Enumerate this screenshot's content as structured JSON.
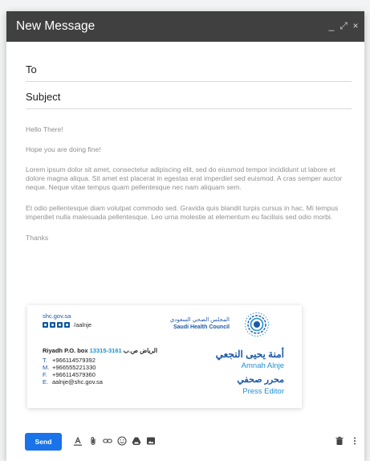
{
  "header": {
    "title": "New Message",
    "controls": {
      "minimize": "_",
      "expand": "⤢",
      "close": "×"
    }
  },
  "fields": {
    "to_label": "To",
    "to_value": "",
    "subject_label": "Subject",
    "subject_value": ""
  },
  "body": {
    "greeting": "Hello There!",
    "line2": "Hope you are doing fine!",
    "para1": "Lorem ipsum dolor sit amet, consectetur adipiscing elit, sed do eiusmod tempor incididunt ut labore et dolore magna aliqua. Sit amet est placerat in egestas erat imperdiet sed euismod. A cras semper auctor neque. Neque vitae tempus quam pellentesque nec nam aliquam sem.",
    "para2": " Et odio pellentesque diam volutpat commodo sed. Gravida quis blandit turpis cursus in hac. Mi tempus imperdiet nulla malesuada pellentesque. Leo urna molestie at elementum eu facilisis sed odio morbi.",
    "closing": "Thanks"
  },
  "signature": {
    "website": "shc.gov.sa",
    "handle": "/aalnje",
    "org_ar": "المجلس الصحي السعودي",
    "org_en": "Saudi Health Council",
    "address_en": "Riyadh P.O. box",
    "address_num": "13315-3161",
    "address_ar": "الرياض ص.ب",
    "tel_key": "T.",
    "tel": "+966114579392",
    "mobile_key": "M.",
    "mobile": "+966555221330",
    "fax_key": "F.",
    "fax": "+966114579360",
    "email_key": "E.",
    "email": "aalnje@shc.gov.sa",
    "name_ar": "أمنة يحيى النجعي",
    "name_en": "Amnah Alnje",
    "title_ar": "محرر صحفي",
    "title_en": "Press Editor"
  },
  "toolbar": {
    "send_label": "Send",
    "icons": [
      "format-text-icon",
      "attach-icon",
      "link-icon",
      "emoji-icon",
      "drive-icon",
      "photo-icon",
      "trash-icon",
      "more-icon"
    ]
  },
  "colors": {
    "header_bg": "#404040",
    "send_blue": "#1a73e8",
    "brand_blue": "#1d59a8",
    "brand_light_blue": "#1d8fd1",
    "body_text": "#909090"
  }
}
